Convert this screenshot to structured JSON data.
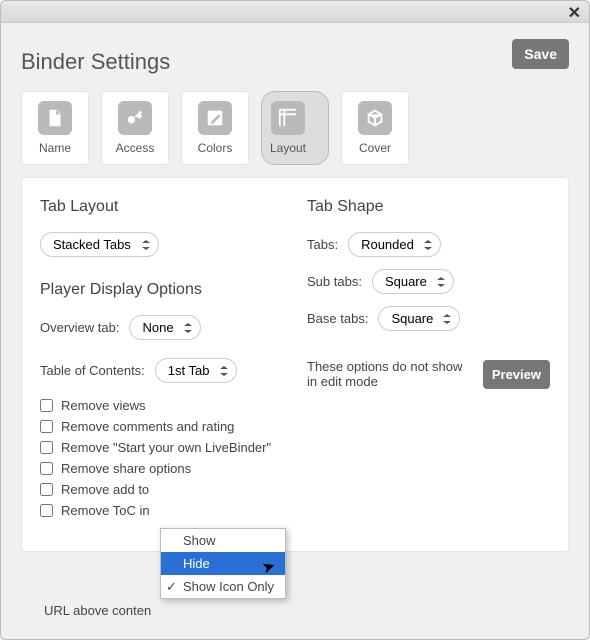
{
  "header": {
    "title": "Binder Settings",
    "save_label": "Save",
    "close_glyph": "✕"
  },
  "topTabs": [
    {
      "id": "name",
      "label": "Name"
    },
    {
      "id": "access",
      "label": "Access"
    },
    {
      "id": "colors",
      "label": "Colors"
    },
    {
      "id": "layout",
      "label": "Layout"
    },
    {
      "id": "cover",
      "label": "Cover"
    }
  ],
  "left": {
    "tabLayoutTitle": "Tab Layout",
    "tabLayoutValue": "Stacked Tabs",
    "playerTitle": "Player Display Options",
    "overviewLabel": "Overview tab:",
    "overviewValue": "None",
    "tocLabel": "Table of Contents:",
    "tocValue": "1st Tab",
    "checks": [
      "Remove views",
      "Remove comments and rating",
      "Remove \"Start your own LiveBinder\"",
      "Remove share options",
      "Remove add to",
      "Remove ToC in"
    ],
    "urlAbove": "URL above conten"
  },
  "right": {
    "shapeTitle": "Tab Shape",
    "tabsLabel": "Tabs:",
    "tabsValue": "Rounded",
    "subLabel": "Sub tabs:",
    "subValue": "Square",
    "baseLabel": "Base tabs:",
    "baseValue": "Square",
    "note": "These options do not show in edit mode",
    "previewLabel": "Preview"
  },
  "contextMenu": {
    "items": [
      "Show",
      "Hide",
      "Show Icon Only"
    ],
    "highlighted": "Hide",
    "checked": "Show Icon Only"
  }
}
